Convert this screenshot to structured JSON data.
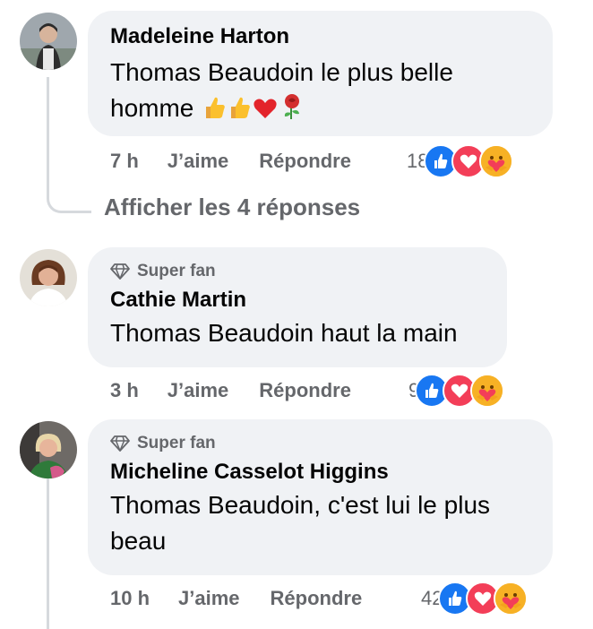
{
  "comments": [
    {
      "author": "Madeleine Harton",
      "text": "Thomas Beaudoin le plus belle homme",
      "time": "7 h",
      "like_label": "J’aime",
      "reply_label": "Répondre",
      "reaction_count": "18",
      "badge": ""
    },
    {
      "author": "Cathie Martin",
      "text": "Thomas Beaudoin haut la main",
      "time": "3 h",
      "like_label": "J’aime",
      "reply_label": "Répondre",
      "reaction_count": "9",
      "badge": "Super fan"
    },
    {
      "author": "Micheline Casselot Higgins",
      "text": "Thomas Beaudoin, c'est lui le plus beau",
      "time": "10 h",
      "like_label": "J’aime",
      "reply_label": "Répondre",
      "reaction_count": "42",
      "badge": "Super fan"
    }
  ],
  "view_replies_label": "Afficher les 4 réponses",
  "colors": {
    "bubble": "#f0f2f5",
    "meta_text": "#65676b",
    "like_blue": "#1877f2",
    "love_red": "#f33e58",
    "care_yellow": "#f7b125"
  },
  "icons": [
    "thumbs-up-emoji",
    "heart-emoji",
    "rose-emoji",
    "diamond-icon",
    "like-reaction-icon",
    "love-reaction-icon",
    "care-reaction-icon"
  ]
}
